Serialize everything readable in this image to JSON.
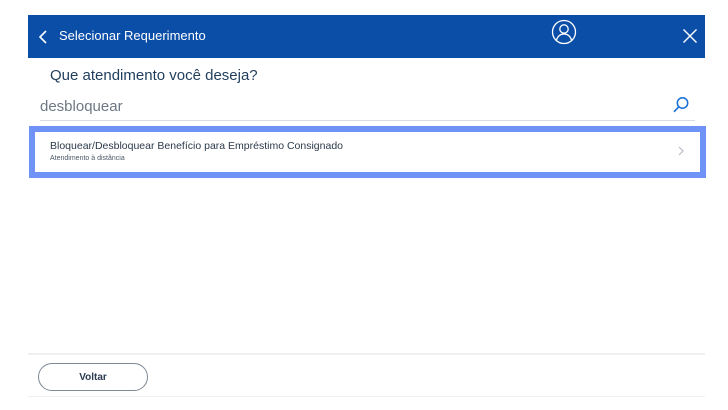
{
  "header": {
    "title": "Selecionar Requerimento",
    "back_icon": "chevron-left-icon",
    "avatar_icon": "user-avatar-icon",
    "close_icon": "close-icon",
    "background_color": "#0b4ea8"
  },
  "main": {
    "question": "Que atendimento você deseja?",
    "search": {
      "value": "desbloquear",
      "icon": "search-icon"
    },
    "results": [
      {
        "title": "Bloquear/Desbloquear Benefício para Empréstimo Consignado",
        "subtitle": "Atendimento à distância",
        "selected": true
      }
    ],
    "selection_color": "#6f92f7"
  },
  "footer": {
    "back_label": "Voltar"
  }
}
